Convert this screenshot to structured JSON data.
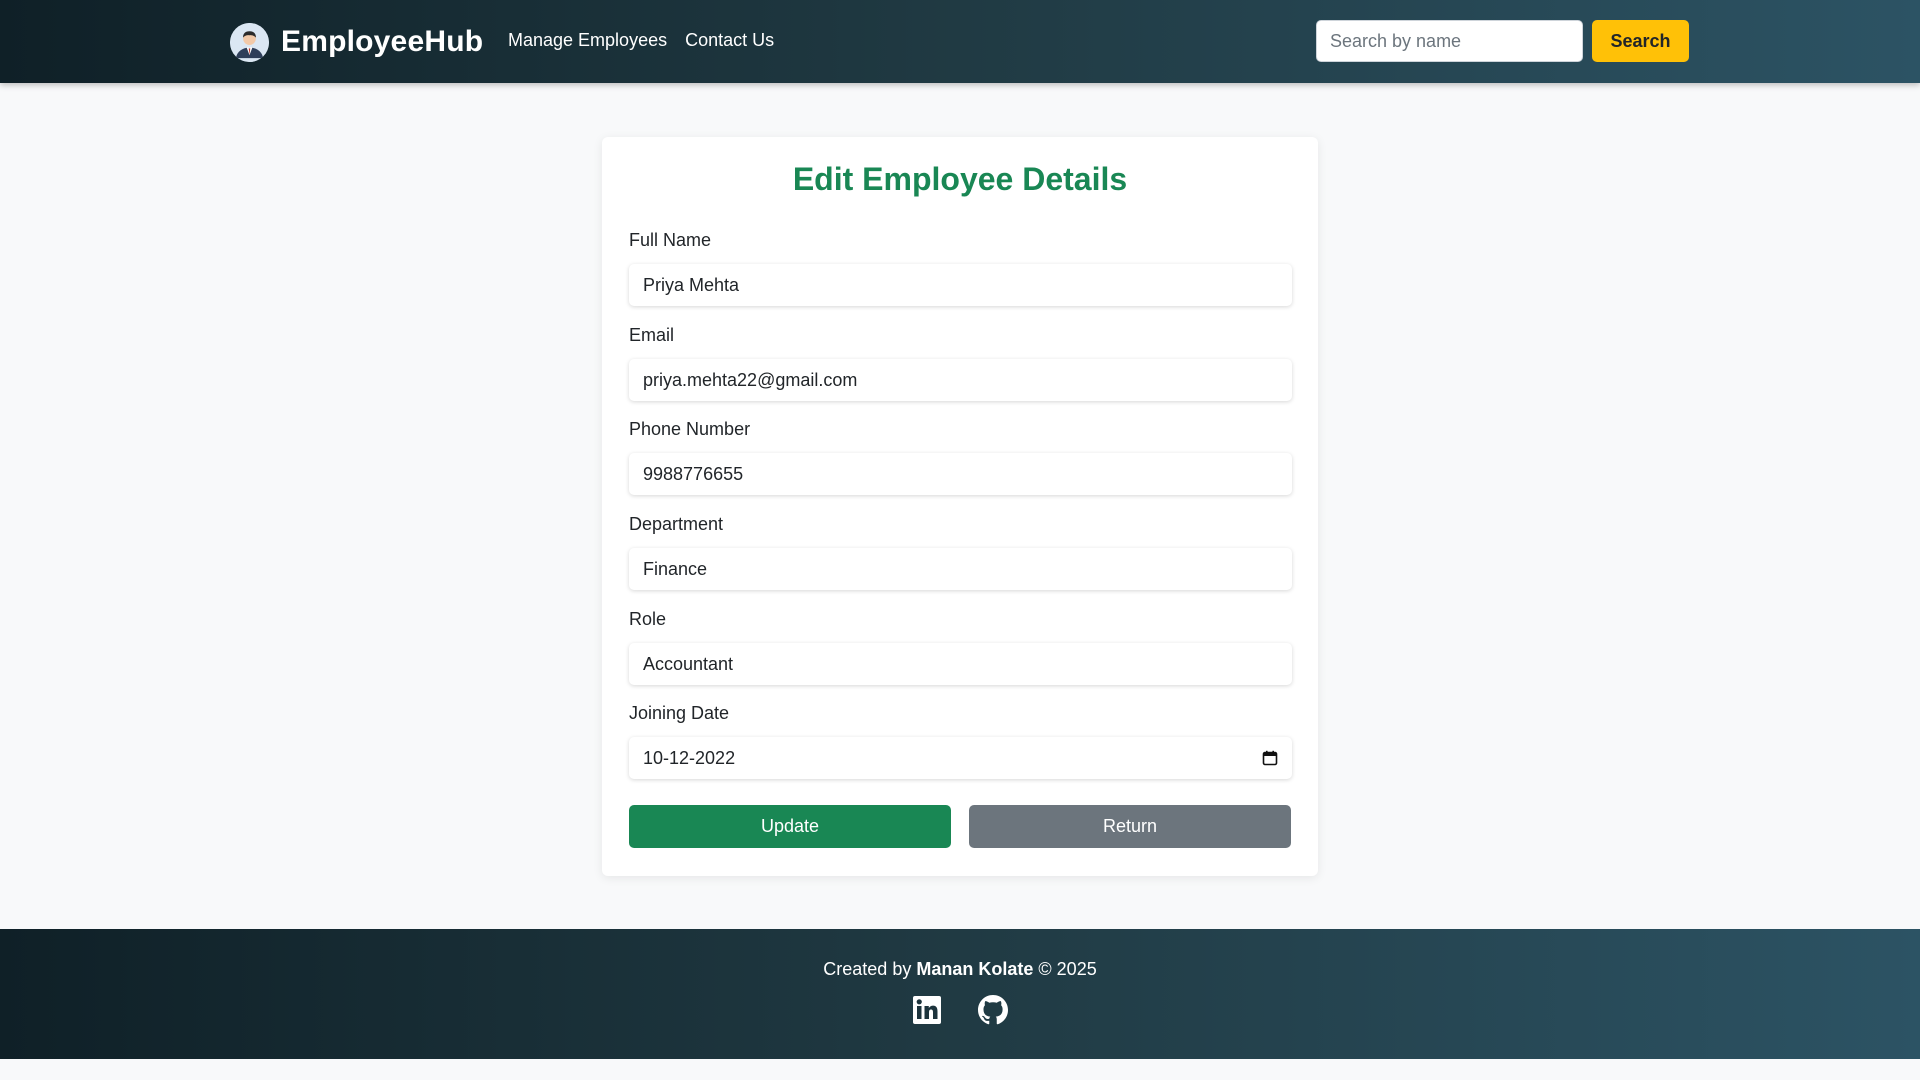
{
  "navbar": {
    "brand": "EmployeeHub",
    "brand_icon": "user-avatar-icon",
    "links": [
      "Manage Employees",
      "Contact Us"
    ],
    "search_placeholder": "Search by name",
    "search_value": "",
    "search_button": "Search"
  },
  "form": {
    "title": "Edit Employee Details",
    "fields": [
      {
        "label": "Full Name",
        "value": "Priya Mehta"
      },
      {
        "label": "Email",
        "value": "priya.mehta22@gmail.com"
      },
      {
        "label": "Phone Number",
        "value": "9988776655"
      },
      {
        "label": "Department",
        "value": "Finance"
      },
      {
        "label": "Role",
        "value": "Accountant"
      },
      {
        "label": "Joining Date",
        "value": "10-12-2022"
      }
    ],
    "update_button": "Update",
    "return_button": "Return"
  },
  "footer": {
    "prefix": "Created by",
    "author": "Manan Kolate",
    "suffix": "© 2025",
    "social_icons": [
      "linkedin-icon",
      "github-icon"
    ]
  },
  "colors": {
    "primary_green": "#198754",
    "secondary_gray": "#6c757d",
    "accent_yellow": "#ffc107",
    "header_gradient": [
      "#0f2027",
      "#203a43",
      "#2c5364"
    ]
  }
}
